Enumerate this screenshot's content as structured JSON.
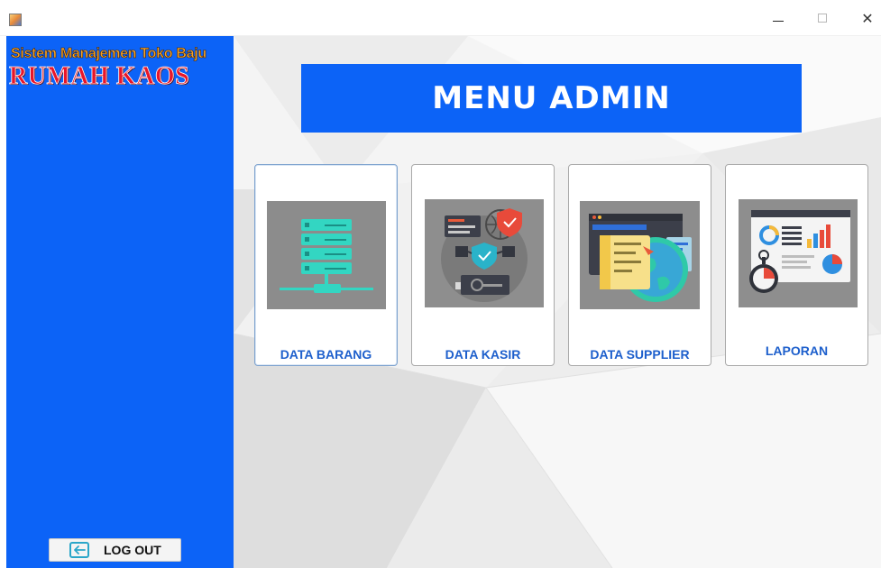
{
  "window": {
    "minimize_icon": "minimize-icon",
    "maximize_icon": "maximize-icon",
    "close_glyph": "✕"
  },
  "sidebar": {
    "brand_subtitle": "Sistem Manajemen Toko Baju",
    "brand_title": "RUMAH KAOS",
    "logout_label": "LOG OUT",
    "logout_icon": "logout-arrow-icon",
    "background_color": "#0c63f7"
  },
  "main": {
    "title": "MENU ADMIN",
    "banner_color": "#0c63f7",
    "cards": [
      {
        "label": "DATA BARANG",
        "icon": "server-stack-icon"
      },
      {
        "label": "DATA KASIR",
        "icon": "security-network-icon"
      },
      {
        "label": "DATA SUPPLIER",
        "icon": "globe-window-icon"
      },
      {
        "label": "LAPORAN",
        "icon": "report-dashboard-icon"
      }
    ]
  },
  "colors": {
    "accent": "#0c63f7",
    "card_label": "#1d5fcc",
    "brand_red": "#e8162a",
    "brand_orange": "#f5a42a"
  }
}
